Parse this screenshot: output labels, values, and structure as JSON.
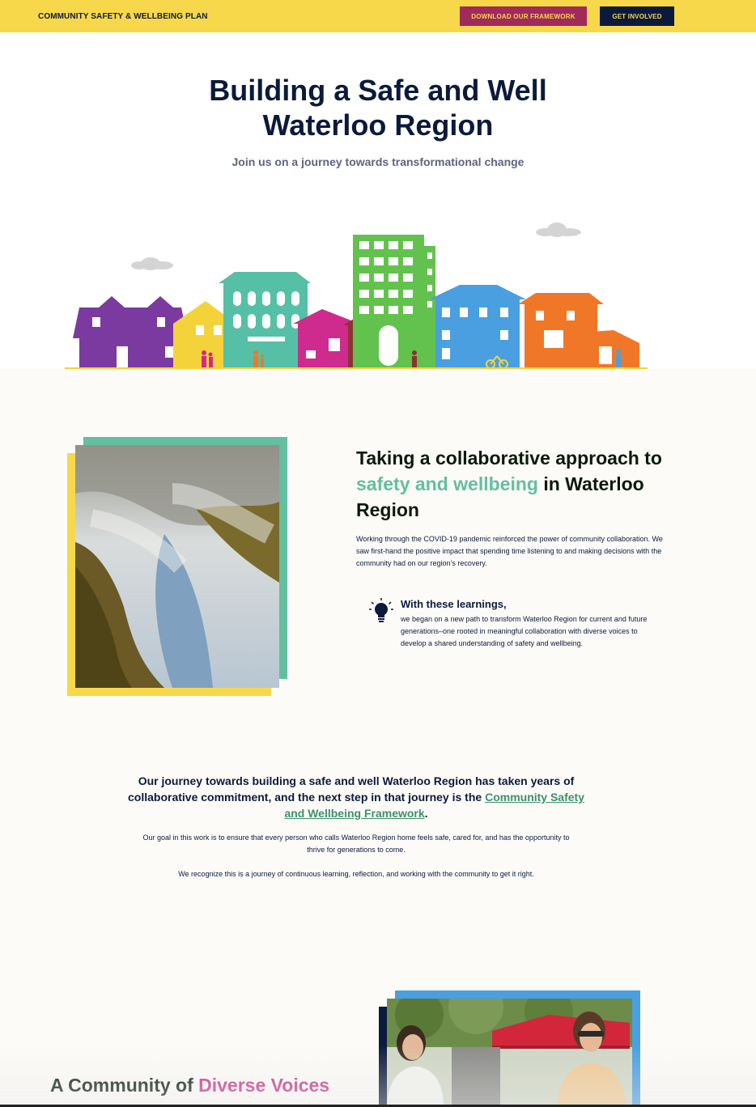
{
  "header": {
    "brand": "COMMUNITY SAFETY & WELLBEING PLAN",
    "download_label": "DOWNLOAD OUR FRAMEWORK",
    "involved_label": "GET INVOLVED",
    "bar_color": "#f7d84a"
  },
  "hero": {
    "title_line1": "Building a Safe and Well",
    "title_line2": "Waterloo Region",
    "subtitle": "Join us on a journey towards transformational change"
  },
  "collab": {
    "title_pre": "Taking a collaborative approach to",
    "title_highlight": "safety and wellbeing",
    "title_post": "in Waterloo Region",
    "body": "Working through the COVID-19 pandemic reinforced the power of community collaboration. We saw first-hand the positive impact that spending time listening to and making decisions with the community had on our region’s recovery.",
    "learnings_title": "With these learnings,",
    "learnings_body": "we began on a new path to transform Waterloo Region for current and future generations–one rooted in meaningful collaboration with diverse voices to develop a shared understanding of safety and wellbeing.",
    "icon": "lightbulb-icon"
  },
  "journey": {
    "statement_pre": "Our journey towards building a safe and well Waterloo Region has taken years of collaborative commitment, and the next step in that journey is the",
    "framework_link": "Community Safety and Wellbeing Framework",
    "statement_post": ".",
    "goal": "Our goal in this work is to ensure that every person who calls Waterloo Region home feels safe, cared for, and has the opportunity to thrive for generations to come.",
    "recognize": "We recognize this is a journey of continuous learning, reflection, and working with the community to get it right."
  },
  "community": {
    "title_pre": "A Community of",
    "title_highlight": "Diverse Voices"
  },
  "colors": {
    "navy": "#0b1a3c",
    "yellow": "#f7d84a",
    "teal": "#63bfa0",
    "magenta": "#a02a5c",
    "pink": "#c83486",
    "blue": "#4a9fe0"
  }
}
